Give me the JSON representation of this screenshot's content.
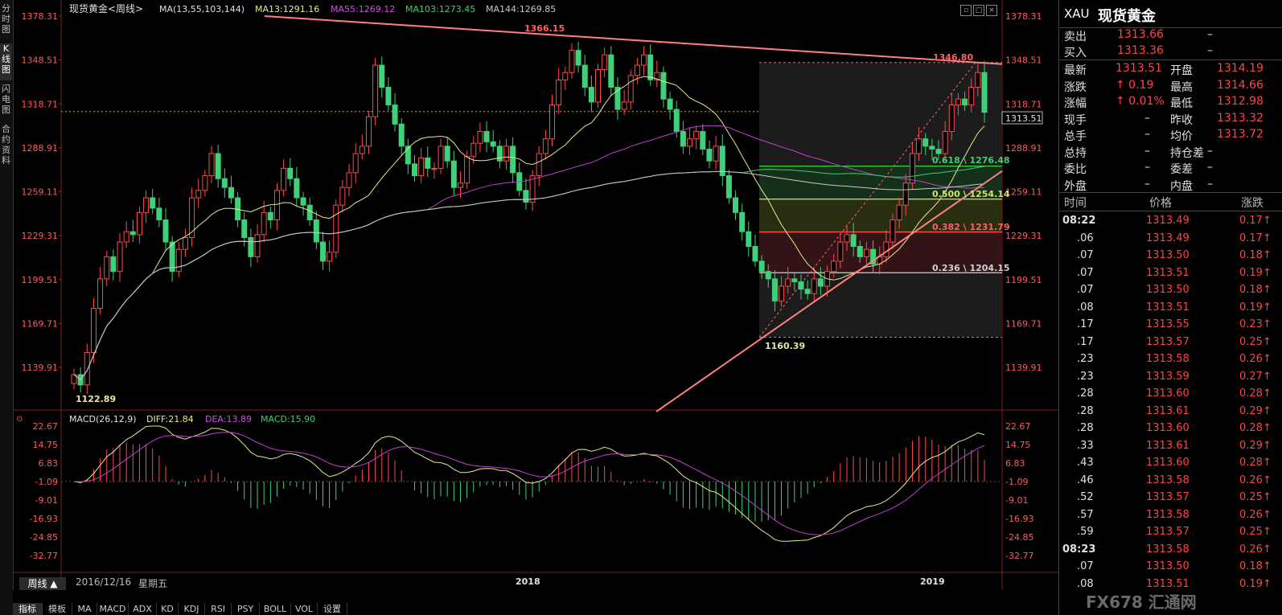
{
  "symbol": {
    "title": "现货黄金<周线>",
    "code": "XAU",
    "name": "现货黄金"
  },
  "ma_legend": {
    "label": "MA(13,55,103,144)",
    "ma13": "MA13:1291.16",
    "ma55": "MA55:1269.12",
    "ma103": "MA103:1273.45",
    "ma144": "MA144:1269.85"
  },
  "macd_legend": {
    "label": "MACD(26,12,9)",
    "diff": "DIFF:21.84",
    "dea": "DEA:13.89",
    "macd": "MACD:15.90"
  },
  "left_tabs": [
    "分时图",
    "K线图",
    "闪电图",
    "合约资料"
  ],
  "price_axis": [
    "1378.31",
    "1348.51",
    "1318.71",
    "1288.91",
    "1259.11",
    "1229.31",
    "1199.51",
    "1169.71",
    "1139.91"
  ],
  "macd_axis": [
    "22.67",
    "14.75",
    "6.83",
    "-1.09",
    "-9.01",
    "-16.93",
    "-24.85",
    "-32.77"
  ],
  "current_price_tag": "1313.51",
  "annotations": {
    "high1": "1366.15",
    "high2": "1346.80",
    "low1": "1122.89",
    "low2": "1160.39"
  },
  "fib_levels": [
    "0.618 \\ 1276.48",
    "0.500 \\ 1254.14",
    "0.382 \\ 1231.79",
    "0.236 \\ 1204.15"
  ],
  "x_axis": {
    "start_date": "2016/12/16",
    "start_weekday": "星期五",
    "year_2018": "2018",
    "year_2019": "2019"
  },
  "bottom": {
    "cycle_button": "周线 ▲",
    "tabs": [
      "指标",
      "模板",
      "MA",
      "MACD",
      "ADX",
      "KD",
      "KDJ",
      "RSI",
      "PSY",
      "BOLL",
      "VOL",
      "设置"
    ]
  },
  "quote": {
    "sell_label": "卖出",
    "sell_value": "1313.66",
    "sell_extra": "–",
    "buy_label": "买入",
    "buy_value": "1313.36",
    "buy_extra": "–",
    "rows": [
      {
        "l1": "最新",
        "v1": "1313.51",
        "l2": "开盘",
        "v2": "1314.19"
      },
      {
        "l1": "涨跌",
        "v1": "↑ 0.19",
        "l2": "最高",
        "v2": "1314.66"
      },
      {
        "l1": "涨幅",
        "v1": "↑ 0.01%",
        "l2": "最低",
        "v2": "1312.98"
      },
      {
        "l1": "现手",
        "v1": "–",
        "l2": "昨收",
        "v2": "1313.32"
      },
      {
        "l1": "总手",
        "v1": "–",
        "l2": "均价",
        "v2": "1313.72"
      },
      {
        "l1": "总持",
        "v1": "–",
        "l2": "持仓差",
        "v2": "–"
      },
      {
        "l1": "委比",
        "v1": "–",
        "l2": "委差",
        "v2": "–"
      },
      {
        "l1": "外盘",
        "v1": "–",
        "l2": "内盘",
        "v2": "–"
      }
    ]
  },
  "ticks_header": {
    "time": "时间",
    "price": "价格",
    "change": "涨跌"
  },
  "ticks": [
    {
      "time": "08:22",
      "price": "1313.49",
      "change": "0.17↑"
    },
    {
      "time": ".06",
      "price": "1313.49",
      "change": "0.17↑"
    },
    {
      "time": ".07",
      "price": "1313.50",
      "change": "0.18↑"
    },
    {
      "time": ".07",
      "price": "1313.51",
      "change": "0.19↑"
    },
    {
      "time": ".07",
      "price": "1313.50",
      "change": "0.18↑"
    },
    {
      "time": ".08",
      "price": "1313.51",
      "change": "0.19↑"
    },
    {
      "time": ".17",
      "price": "1313.55",
      "change": "0.23↑"
    },
    {
      "time": ".17",
      "price": "1313.57",
      "change": "0.25↑"
    },
    {
      "time": ".23",
      "price": "1313.58",
      "change": "0.26↑"
    },
    {
      "time": ".23",
      "price": "1313.59",
      "change": "0.27↑"
    },
    {
      "time": ".28",
      "price": "1313.60",
      "change": "0.28↑"
    },
    {
      "time": ".28",
      "price": "1313.61",
      "change": "0.29↑"
    },
    {
      "time": ".28",
      "price": "1313.60",
      "change": "0.28↑"
    },
    {
      "time": ".33",
      "price": "1313.61",
      "change": "0.29↑"
    },
    {
      "time": ".43",
      "price": "1313.60",
      "change": "0.28↑"
    },
    {
      "time": ".46",
      "price": "1313.58",
      "change": "0.26↑"
    },
    {
      "time": ".52",
      "price": "1313.57",
      "change": "0.25↑"
    },
    {
      "time": ".57",
      "price": "1313.58",
      "change": "0.26↑"
    },
    {
      "time": ".59",
      "price": "1313.57",
      "change": "0.25↑"
    },
    {
      "time": "08:23",
      "price": "1313.58",
      "change": "0.26↑"
    },
    {
      "time": ".07",
      "price": "1313.50",
      "change": "0.18↑"
    },
    {
      "time": ".08",
      "price": "1313.51",
      "change": "0.19↑"
    }
  ],
  "watermark": "FX678 汇通网",
  "colors": {
    "up": "#ff4a4a",
    "down": "#3ed17a",
    "ma13": "#e8e890",
    "ma55": "#c040d0",
    "ma103": "#3fcf6a",
    "ma144": "#c8c8c8",
    "trend": "#ff8080"
  }
}
